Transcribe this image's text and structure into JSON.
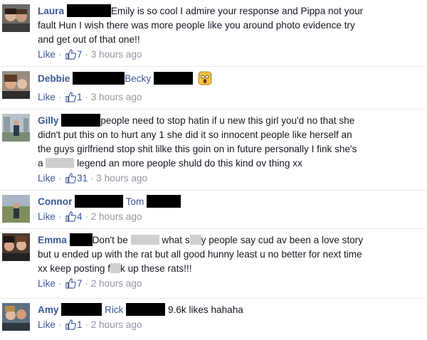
{
  "comments": [
    {
      "name": "Laura",
      "line1": "Emily is so cool I admire your response and Pippa not your",
      "line2": "fault Hun I wish there was more people like you around photo evidence try",
      "line3": "and get out of that one!!",
      "like": "Like",
      "sep": "·",
      "likes": "7",
      "time": "3 hours ago"
    },
    {
      "name": "Debbie",
      "tag": "Becky",
      "like": "Like",
      "sep": "·",
      "likes": "1",
      "time": "3 hours ago",
      "emoji": "scream-emoji"
    },
    {
      "name": "Gilly",
      "line1": "people need to stop hatin if u new this girl you'd no that she",
      "line2": "didn't put this on to hurt any 1 she did it so innocent people like herself an",
      "line3": "the guys girlfriend stop shit lilke this goin on in future personally I fink she's",
      "line4_prefix": "a",
      "line4": "legend an more people shuld do this kind ov thing xx",
      "like": "Like",
      "sep": "·",
      "likes": "31",
      "time": "3 hours ago"
    },
    {
      "name": "Connor",
      "tag": "Tom",
      "like": "Like",
      "sep": "·",
      "likes": "4",
      "time": "2 hours ago"
    },
    {
      "name": "Emma",
      "line1a": "Don't be",
      "line1b": "what s",
      "line1c": "y people say cud av been a love story",
      "line2": "but u ended up with the rat but all good hunny least u no better for next time",
      "line3a": "xx keep posting f",
      "line3b": "k up these rats!!!",
      "like": "Like",
      "sep": "·",
      "likes": "7",
      "time": "2 hours ago"
    },
    {
      "name": "Amy",
      "tag": "Rick",
      "line1": "9.6k likes hahaha",
      "like": "Like",
      "sep": "·",
      "likes": "1",
      "time": "2 hours ago"
    }
  ],
  "colors": {
    "link": "#3b5998",
    "meta": "#9197a3",
    "text": "#141823",
    "divider": "#e9eaed"
  },
  "icons": [
    "thumbs-up-icon",
    "scream-emoji"
  ]
}
